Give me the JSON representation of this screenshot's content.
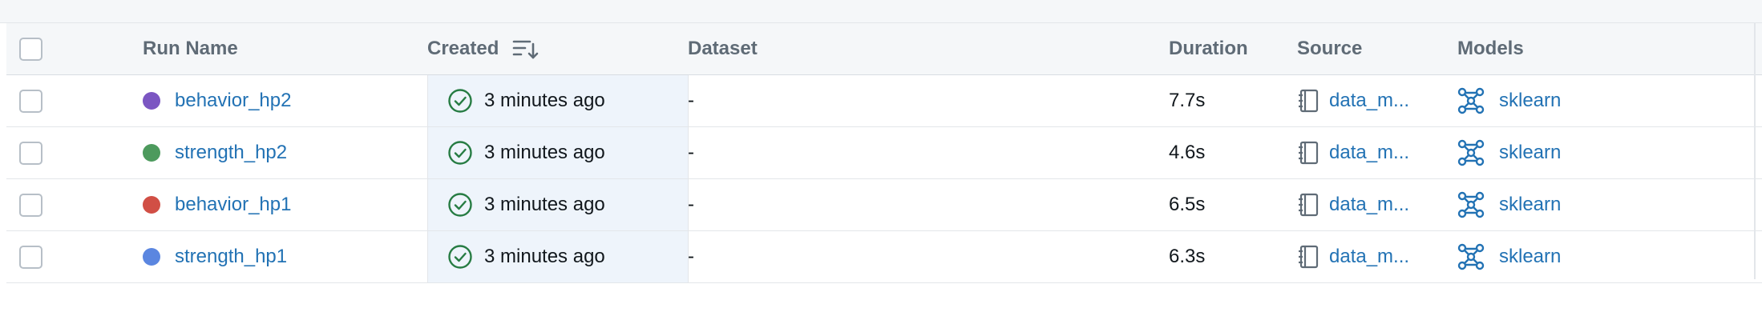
{
  "table": {
    "headers": {
      "run_name": "Run Name",
      "created": "Created",
      "dataset": "Dataset",
      "duration": "Duration",
      "source": "Source",
      "models": "Models"
    },
    "rows": [
      {
        "run_name": "behavior_hp2",
        "color": "#7b56c2",
        "created": "3 minutes ago",
        "dataset": "-",
        "duration": "7.7s",
        "source": "data_m...",
        "model": "sklearn"
      },
      {
        "run_name": "strength_hp2",
        "color": "#4d9a5d",
        "created": "3 minutes ago",
        "dataset": "-",
        "duration": "4.6s",
        "source": "data_m...",
        "model": "sklearn"
      },
      {
        "run_name": "behavior_hp1",
        "color": "#d14f45",
        "created": "3 minutes ago",
        "dataset": "-",
        "duration": "6.5s",
        "source": "data_m...",
        "model": "sklearn"
      },
      {
        "run_name": "strength_hp1",
        "color": "#5b86e0",
        "created": "3 minutes ago",
        "dataset": "-",
        "duration": "6.3s",
        "source": "data_m...",
        "model": "sklearn"
      }
    ]
  },
  "icons": {
    "sort": "sort-descending-icon",
    "status": "check-circle-icon",
    "source": "notebook-icon",
    "model": "model-graph-icon"
  },
  "colors": {
    "link": "#2272b4",
    "success": "#277c43",
    "header_bg": "#f5f7f9",
    "selected_col_bg": "#eef4fb"
  }
}
